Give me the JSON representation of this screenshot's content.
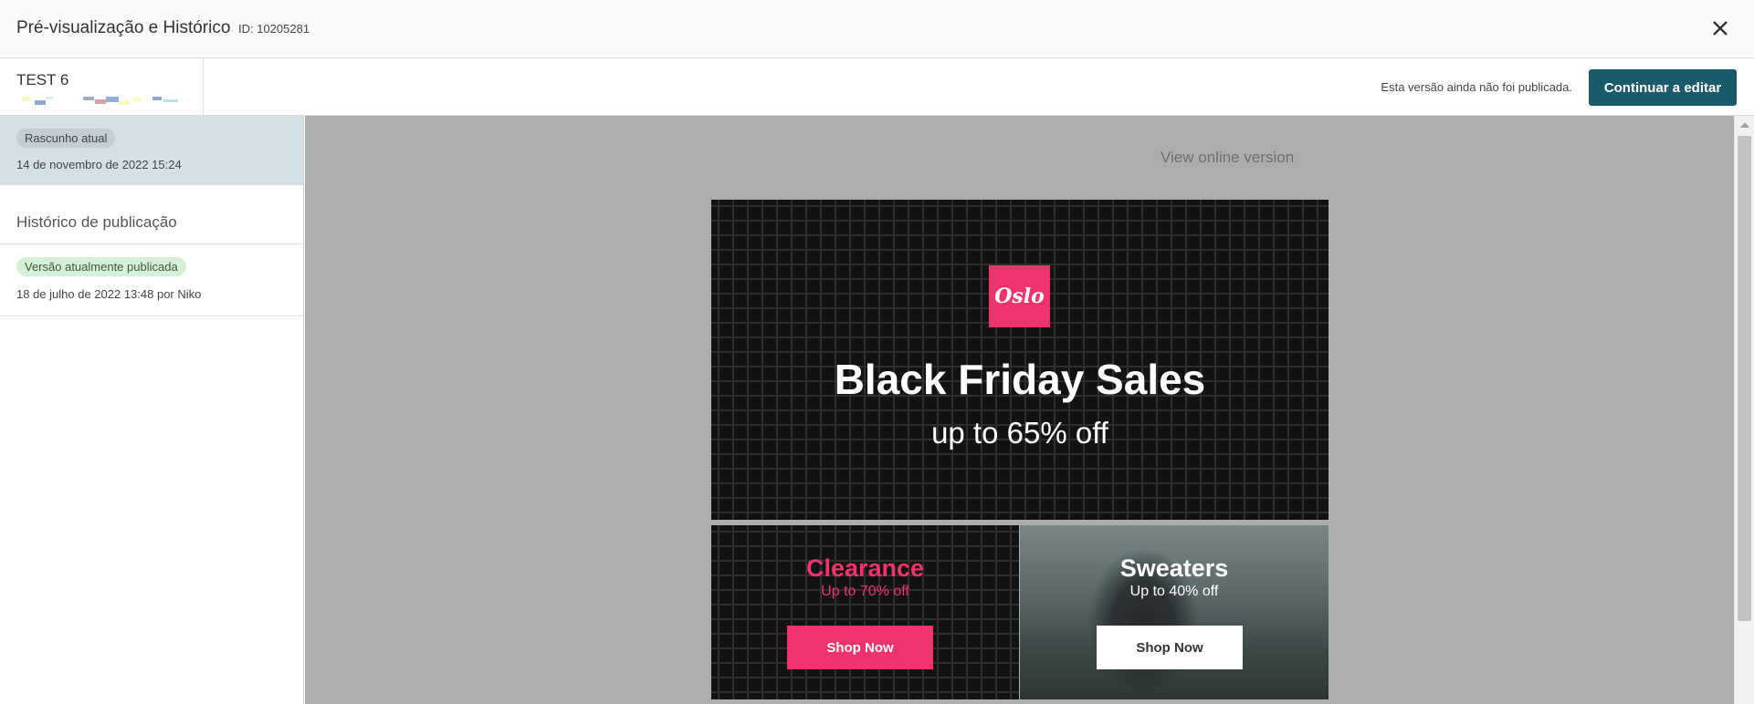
{
  "header": {
    "title": "Pré-visualização e Histórico",
    "id_label": "ID: 10205281",
    "close_icon": "close-icon"
  },
  "subheader": {
    "name": "TEST 6",
    "status_text": "Esta versão ainda não foi publicada.",
    "continue_label": "Continuar a editar"
  },
  "sidebar": {
    "draft": {
      "badge": "Rascunho atual",
      "date": "14 de novembro de 2022 15:24"
    },
    "history_heading": "Histórico de publicação",
    "published": {
      "badge": "Versão atualmente publicada",
      "date": "18 de julho de 2022 13:48 por Niko"
    }
  },
  "preview": {
    "view_online": "View online version",
    "hero": {
      "logo": "Oslo",
      "title": "Black Friday Sales",
      "subtitle": "up to 65% off"
    },
    "tiles": [
      {
        "heading": "Clearance",
        "offer": "Up to 70% off",
        "button": "Shop Now"
      },
      {
        "heading": "Sweaters",
        "offer": "Up to 40% off",
        "button": "Shop Now"
      }
    ]
  },
  "colors": {
    "accent": "#1a5a6a",
    "brand_pink": "#f0336d",
    "draft_bg": "#d3e0e6",
    "published_badge_bg": "#d6efd7",
    "preview_bg": "#adadad"
  }
}
